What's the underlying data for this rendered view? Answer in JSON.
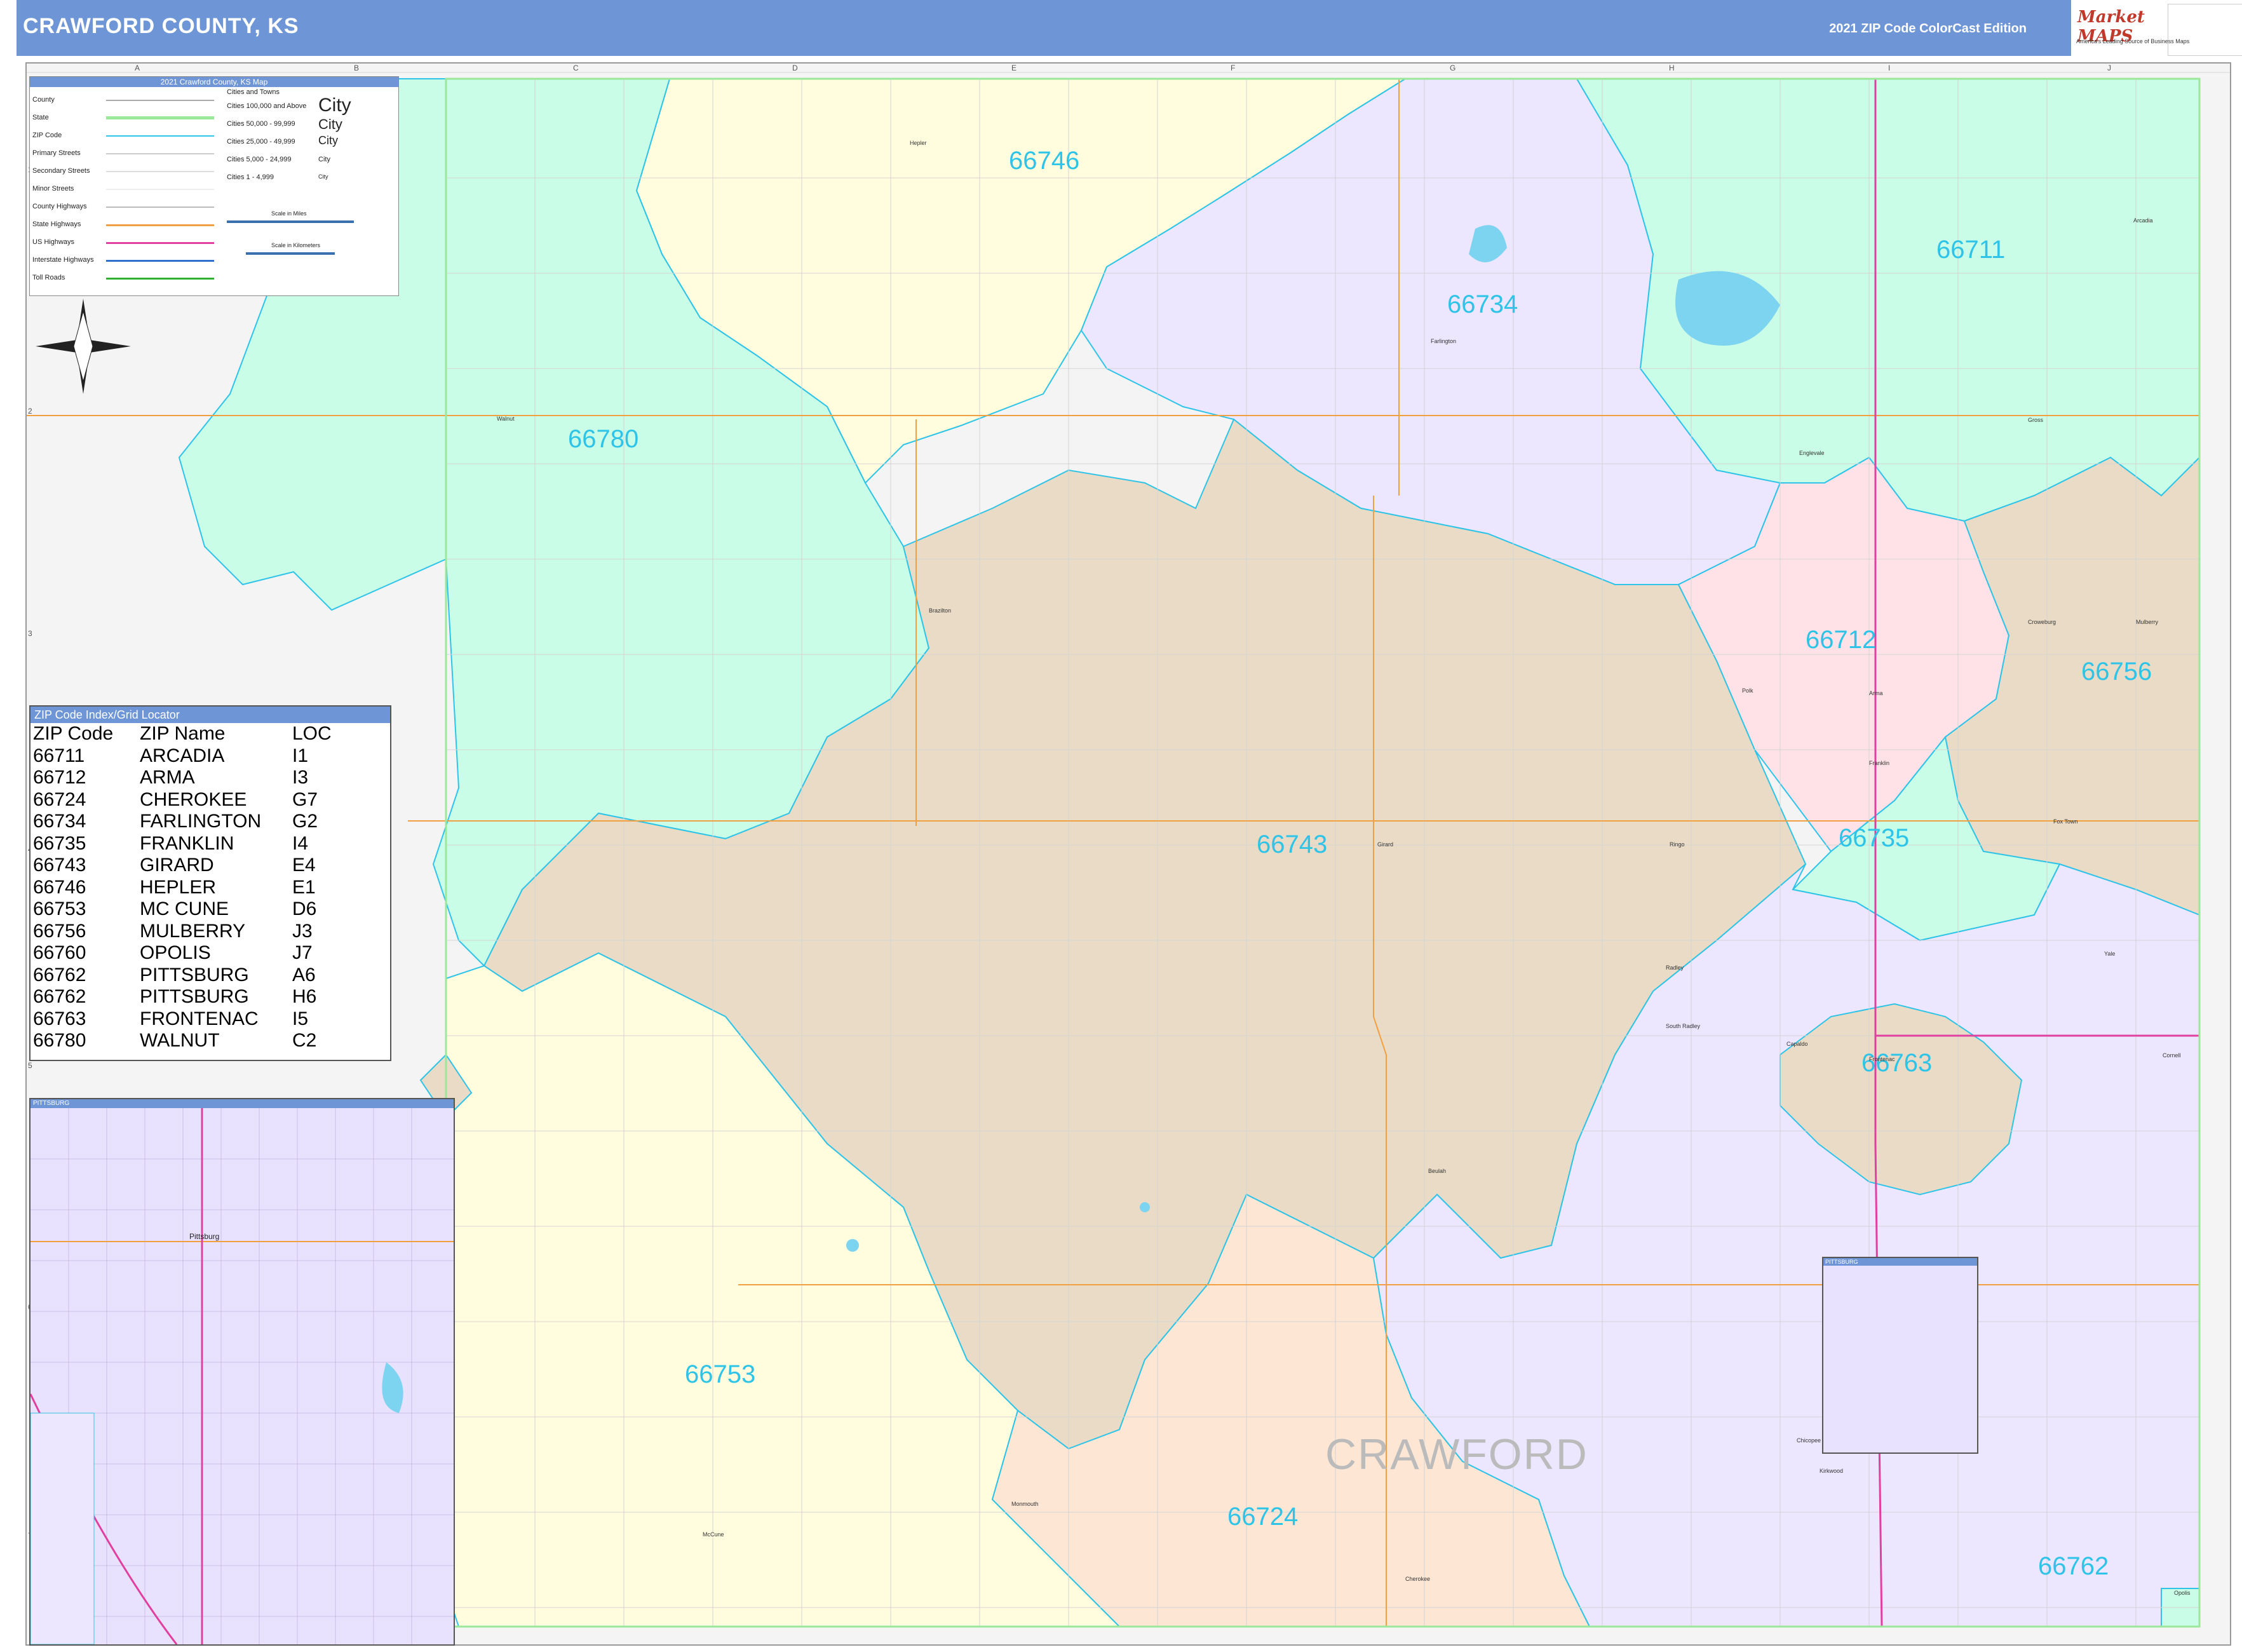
{
  "header": {
    "title": "CRAWFORD COUNTY, KS",
    "edition": "2021 ZIP Code ColorCast Edition"
  },
  "logo": {
    "name": "Market MAPS",
    "tagline": "America's Leading Source of Business Maps"
  },
  "legend": {
    "title": "2021 Crawford County, KS Map",
    "items": [
      {
        "label": "County",
        "color": "#aaaaaa"
      },
      {
        "label": "State",
        "color": "#9be89b"
      },
      {
        "label": "ZIP Code",
        "color": "#2ec4e8"
      },
      {
        "label": "Primary Streets",
        "color": "#cccccc"
      },
      {
        "label": "Secondary Streets",
        "color": "#dddddd"
      },
      {
        "label": "Minor Streets",
        "color": "#eeeeee"
      },
      {
        "label": "County Highways",
        "color": "#bbbbbb"
      },
      {
        "label": "State Highways",
        "color": "#f0a040"
      },
      {
        "label": "US Highways",
        "color": "#e040a0"
      },
      {
        "label": "Interstate Highways",
        "color": "#3070d0"
      },
      {
        "label": "Toll Roads",
        "color": "#30b030"
      }
    ],
    "cities_header": "Cities and Towns",
    "city_sizes": [
      {
        "label": "Cities 100,000 and Above",
        "sample": "City"
      },
      {
        "label": "Cities 50,000 - 99,999",
        "sample": "City"
      },
      {
        "label": "Cities 25,000 - 49,999",
        "sample": "City"
      },
      {
        "label": "Cities 5,000 - 24,999",
        "sample": "City"
      },
      {
        "label": "Cities 1 - 4,999",
        "sample": "City"
      }
    ],
    "scale_miles": "Scale in Miles",
    "scale_km": "Scale in Kilometers"
  },
  "zip_index": {
    "title": "ZIP Code Index/Grid Locator",
    "columns": [
      "ZIP Code",
      "ZIP Name",
      "LOC"
    ],
    "rows": [
      [
        "66711",
        "ARCADIA",
        "I1"
      ],
      [
        "66712",
        "ARMA",
        "I3"
      ],
      [
        "66724",
        "CHEROKEE",
        "G7"
      ],
      [
        "66734",
        "FARLINGTON",
        "G2"
      ],
      [
        "66735",
        "FRANKLIN",
        "I4"
      ],
      [
        "66743",
        "GIRARD",
        "E4"
      ],
      [
        "66746",
        "HEPLER",
        "E1"
      ],
      [
        "66753",
        "MC CUNE",
        "D6"
      ],
      [
        "66756",
        "MULBERRY",
        "J3"
      ],
      [
        "66760",
        "OPOLIS",
        "J7"
      ],
      [
        "66762",
        "PITTSBURG",
        "A6"
      ],
      [
        "66762",
        "PITTSBURG",
        "H6"
      ],
      [
        "66763",
        "FRONTENAC",
        "I5"
      ],
      [
        "66780",
        "WALNUT",
        "C2"
      ]
    ]
  },
  "inset": {
    "title": "PITTSBURG",
    "town": "Pittsburg"
  },
  "inset2": {
    "title": "PITTSBURG"
  },
  "county_label": "CRAWFORD",
  "zones": [
    {
      "zip": "66746",
      "color": "#fffddd"
    },
    {
      "zip": "66734",
      "color": "#ece6ff"
    },
    {
      "zip": "66711",
      "color": "#c9fde8"
    },
    {
      "zip": "66780",
      "color": "#c9fde8"
    },
    {
      "zip": "66712",
      "color": "#ffe2e8"
    },
    {
      "zip": "66756",
      "color": "#e9dbc6"
    },
    {
      "zip": "66743",
      "color": "#e9dbc6"
    },
    {
      "zip": "66735",
      "color": "#c9fde8"
    },
    {
      "zip": "66763",
      "color": "#e9dbc6"
    },
    {
      "zip": "66753",
      "color": "#fffddd"
    },
    {
      "zip": "66724",
      "color": "#fde6d4"
    },
    {
      "zip": "66762",
      "color": "#ece6ff"
    },
    {
      "zip": "66760",
      "color": "#c9fde8"
    }
  ],
  "towns": [
    "Hepler",
    "Farlington",
    "Walnut",
    "Englevale",
    "Girard",
    "Brazilton",
    "Polk",
    "Arma",
    "Franklin",
    "Croweburg",
    "Mulberry",
    "Fox Town",
    "Radley",
    "South Radley",
    "Capaldo",
    "Frontenac",
    "Yale",
    "Cornell",
    "Ringo",
    "Beulah",
    "Chicopee",
    "Kirkwood",
    "Cherokee",
    "Monmouth",
    "McCune",
    "Arcadia",
    "Opolis",
    "Gross"
  ],
  "grid_cols": [
    "A",
    "B",
    "C",
    "D",
    "E",
    "F",
    "G",
    "H",
    "I",
    "J"
  ],
  "grid_rows": [
    "1",
    "2",
    "3",
    "4",
    "5",
    "6",
    "7"
  ]
}
